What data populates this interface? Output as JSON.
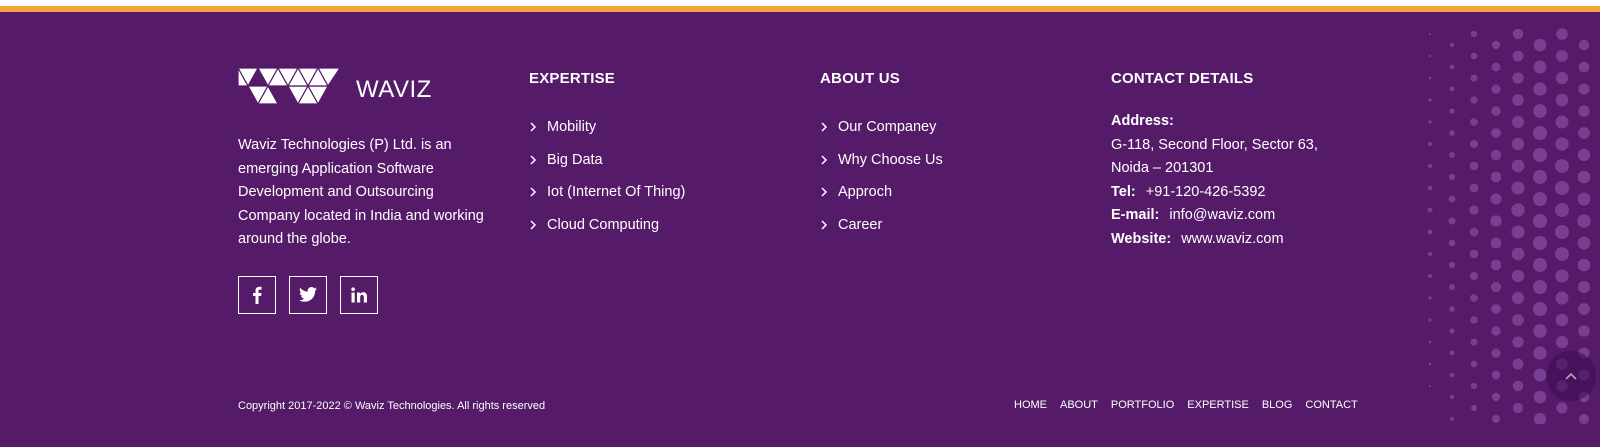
{
  "brand": {
    "name": "WAVIZ",
    "description": "Waviz Technologies (P) Ltd. is an emerging Application Software Development and Outsourcing Company located in India and working around the globe.",
    "accent_color": "#f4a43a",
    "background_color": "#551b69"
  },
  "social": [
    {
      "icon": "facebook-icon"
    },
    {
      "icon": "twitter-icon"
    },
    {
      "icon": "linkedin-icon"
    }
  ],
  "expertise": {
    "title": "EXPERTISE",
    "items": [
      "Mobility",
      "Big Data",
      "Iot (Internet Of Thing)",
      "Cloud Computing"
    ]
  },
  "about_us": {
    "title": "ABOUT US",
    "items": [
      "Our Companey",
      "Why Choose Us",
      "Approch",
      "Career"
    ]
  },
  "contact": {
    "title": "CONTACT DETAILS",
    "address_label": "Address:",
    "address_line1": "G-118, Second Floor, Sector 63,",
    "address_line2": "Noida – 201301",
    "tel_label": "Tel:",
    "tel_value": "+91-120-426-5392",
    "email_label": "E-mail:",
    "email_value": "info@waviz.com",
    "website_label": "Website:",
    "website_value": "www.waviz.com"
  },
  "copyright": "Copyright 2017-2022 © Waviz Technologies. All rights reserved",
  "bottom_nav": [
    "HOME",
    "ABOUT",
    "PORTFOLIO",
    "EXPERTISE",
    "BLOG",
    "CONTACT"
  ]
}
